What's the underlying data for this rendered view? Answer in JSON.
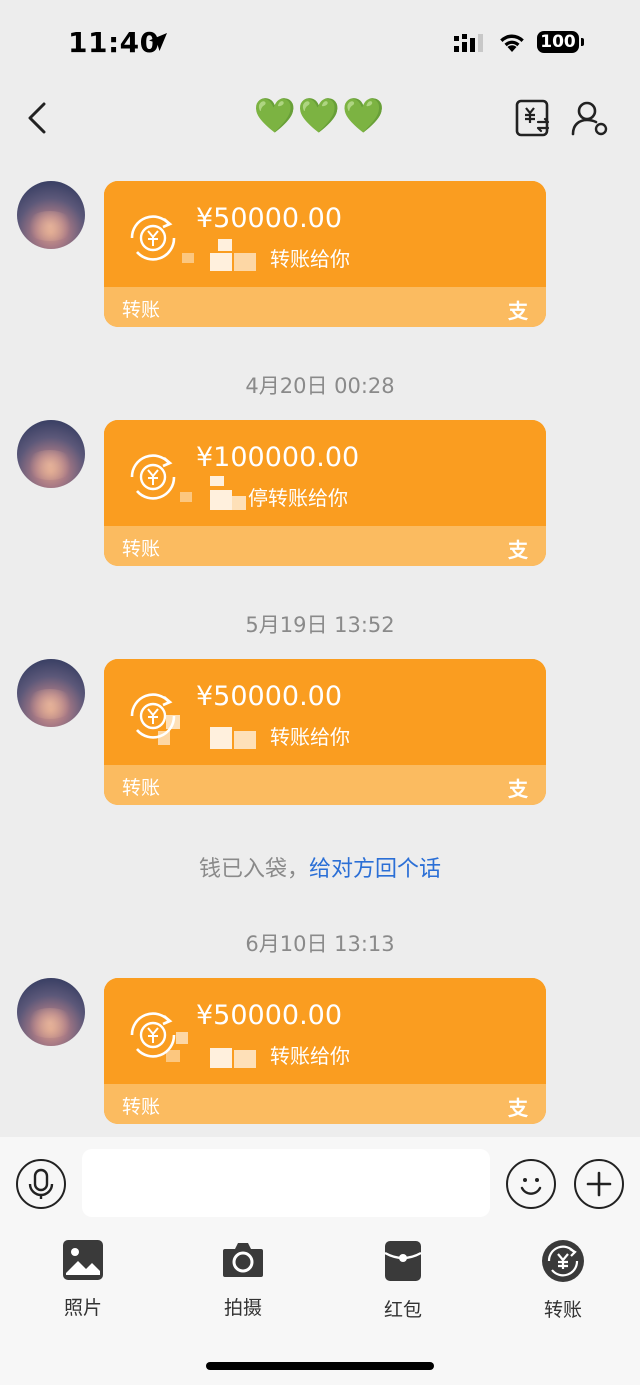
{
  "status_bar": {
    "time": "11:40",
    "battery": "100"
  },
  "nav": {
    "title": "💚💚💚"
  },
  "messages": [
    {
      "amount": "¥50000.00",
      "note": "转账给你",
      "type_label": "转账",
      "pay_mark": "支"
    },
    {
      "amount": "¥100000.00",
      "note": "停转账给你",
      "type_label": "转账",
      "pay_mark": "支"
    },
    {
      "amount": "¥50000.00",
      "note": "转账给你",
      "type_label": "转账",
      "pay_mark": "支"
    },
    {
      "amount": "¥50000.00",
      "note": "转账给你",
      "type_label": "转账",
      "pay_mark": "支"
    }
  ],
  "timestamps": [
    "4月20日 00:28",
    "5月19日 13:52",
    "6月10日 13:13"
  ],
  "system_notice": {
    "text": "钱已入袋，",
    "link": "给对方回个话"
  },
  "input": {
    "placeholder": ""
  },
  "toolbar": [
    {
      "label": "照片",
      "icon": "photo-icon"
    },
    {
      "label": "拍摄",
      "icon": "camera-icon"
    },
    {
      "label": "红包",
      "icon": "red-packet-icon"
    },
    {
      "label": "转账",
      "icon": "transfer-icon"
    }
  ],
  "colors": {
    "card": "#fa9d20",
    "card_footer": "#fbbb60",
    "link": "#2b6fd6",
    "background": "#ededed"
  }
}
